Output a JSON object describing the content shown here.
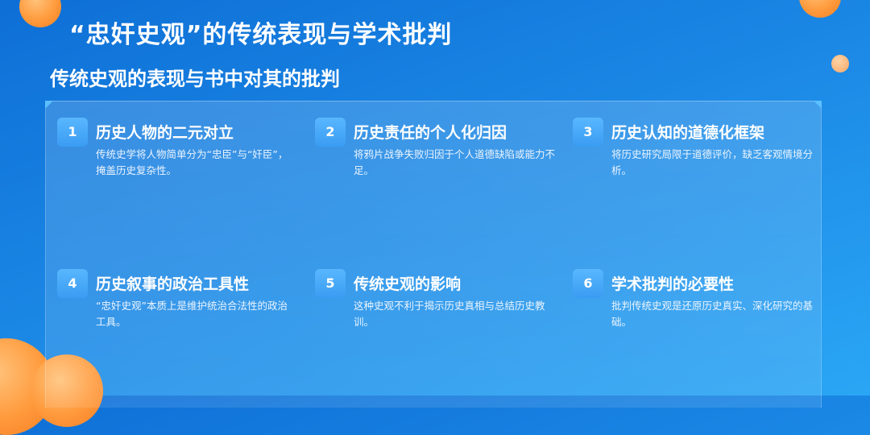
{
  "title": "“忠奸史观”的传统表现与学术批判",
  "subtitle": "传统史观的表现与书中对其的批判",
  "items": [
    {
      "num": "1",
      "title": "历史人物的二元对立",
      "desc": "传统史学将人物简单分为“忠臣”与“奸臣”，掩盖历史复杂性。"
    },
    {
      "num": "2",
      "title": "历史责任的个人化归因",
      "desc": "将鸦片战争失败归因于个人道德缺陷或能力不足。"
    },
    {
      "num": "3",
      "title": "历史认知的道德化框架",
      "desc": "将历史研究局限于道德评价，缺乏客观情境分析。"
    },
    {
      "num": "4",
      "title": "历史叙事的政治工具性",
      "desc": "“忠奸史观”本质上是维护统治合法性的政治工具。"
    },
    {
      "num": "5",
      "title": "传统史观的影响",
      "desc": "这种史观不利于揭示历史真相与总结历史教训。"
    },
    {
      "num": "6",
      "title": "学术批判的必要性",
      "desc": "批判传统史观是还原历史真实、深化研究的基础。"
    }
  ]
}
